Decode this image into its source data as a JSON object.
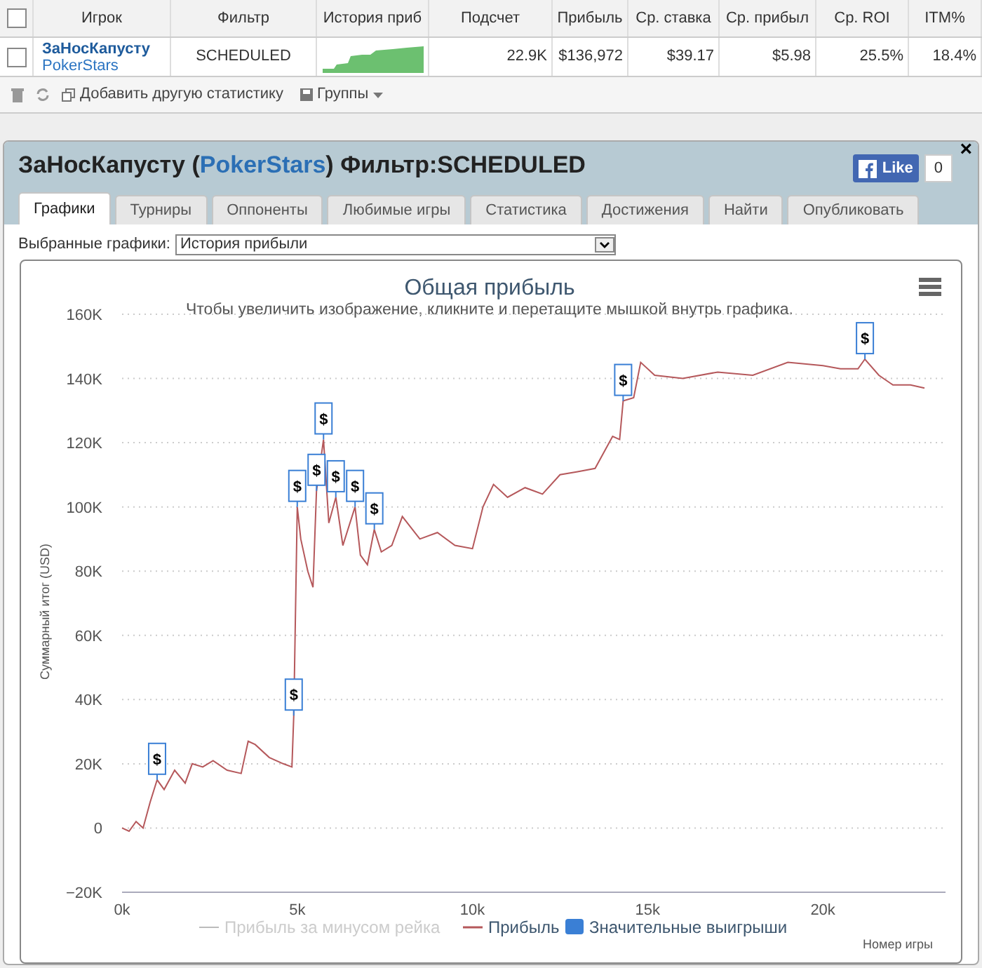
{
  "table": {
    "columns": [
      "Игрок",
      "Фильтр",
      "История приб",
      "Подсчет",
      "Прибыль",
      "Ср. ставка",
      "Ср. прибыл",
      "Ср. ROI",
      "ITM%"
    ],
    "select_all": {
      "checked": false
    },
    "rows": [
      {
        "checked": false,
        "player": "ЗаНосКапусту",
        "site": "PokerStars",
        "filter": "SCHEDULED",
        "count": "22.9K",
        "profit": "$136,972",
        "avg_stake": "$39.17",
        "avg_profit": "$5.98",
        "avg_roi": "25.5%",
        "itm": "18.4%"
      }
    ],
    "toolbar": {
      "add_stat": "Добавить другую статистику",
      "groups": "Группы"
    }
  },
  "panel": {
    "title_player": "ЗаНосКапусту",
    "title_open": " (",
    "title_site": "PokerStars",
    "title_close": ")",
    "title_filter": " Фильтр:SCHEDULED",
    "close": "×",
    "like": "Like",
    "like_count": "0",
    "tabs": [
      {
        "label": "Графики",
        "selected": true
      },
      {
        "label": "Турниры",
        "selected": false
      },
      {
        "label": "Оппоненты",
        "selected": false
      },
      {
        "label": "Любимые игры",
        "selected": false
      },
      {
        "label": "Статистика",
        "selected": false
      },
      {
        "label": "Достижения",
        "selected": false
      },
      {
        "label": "Найти",
        "selected": false
      },
      {
        "label": "Опубликовать",
        "selected": false
      }
    ],
    "select_label": "Выбранные графики:",
    "select_value": "История прибыли",
    "chart_data": {
      "type": "line",
      "title": "Общая прибыль",
      "subtitle": "Чтобы увеличить изображение, кликните и перетащите мышкой внутрь графика.",
      "xlabel": "Номер игры",
      "ylabel": "Суммарный итог (USD)",
      "xticks": [
        {
          "value": 0,
          "label": "0k"
        },
        {
          "value": 5000,
          "label": "5k"
        },
        {
          "value": 10000,
          "label": "10k"
        },
        {
          "value": 15000,
          "label": "15k"
        },
        {
          "value": 20000,
          "label": "20k"
        }
      ],
      "yticks": [
        {
          "value": -20000,
          "label": "−20K"
        },
        {
          "value": 0,
          "label": "0"
        },
        {
          "value": 20000,
          "label": "20K"
        },
        {
          "value": 40000,
          "label": "40K"
        },
        {
          "value": 60000,
          "label": "60K"
        },
        {
          "value": 80000,
          "label": "80K"
        },
        {
          "value": 100000,
          "label": "100K"
        },
        {
          "value": 120000,
          "label": "120K"
        },
        {
          "value": 140000,
          "label": "140K"
        },
        {
          "value": 160000,
          "label": "160K"
        }
      ],
      "xlim": [
        0,
        23500
      ],
      "grid": true,
      "ylim": [
        -20000,
        160000
      ],
      "x": [
        0,
        200,
        400,
        600,
        800,
        1000,
        1200,
        1500,
        1800,
        2000,
        2300,
        2600,
        3000,
        3400,
        3600,
        3800,
        4200,
        4600,
        4850,
        4900,
        5000,
        5100,
        5300,
        5450,
        5550,
        5750,
        5900,
        6100,
        6300,
        6650,
        6800,
        7000,
        7200,
        7400,
        7700,
        8000,
        8500,
        9000,
        9500,
        10000,
        10300,
        10600,
        11000,
        11500,
        12000,
        12500,
        13000,
        13500,
        14000,
        14200,
        14300,
        14600,
        14800,
        15200,
        16000,
        17000,
        18000,
        19000,
        20000,
        20500,
        21000,
        21200,
        21600,
        22000,
        22500,
        22900
      ],
      "series": [
        {
          "name": "Прибыль",
          "color": "#b5585b",
          "values": [
            0,
            -1000,
            2000,
            0,
            8000,
            15000,
            12000,
            18000,
            14000,
            20000,
            19000,
            21000,
            18000,
            17000,
            27000,
            26000,
            22000,
            20000,
            19000,
            35000,
            100000,
            90000,
            80000,
            75000,
            105000,
            121000,
            95000,
            103000,
            88000,
            100000,
            85000,
            82000,
            93000,
            86000,
            88000,
            97000,
            90000,
            92000,
            88000,
            87000,
            100000,
            107000,
            103000,
            106000,
            104000,
            110000,
            111000,
            112000,
            122000,
            121000,
            133000,
            134000,
            145000,
            141000,
            140000,
            142000,
            141000,
            145000,
            144000,
            143000,
            143000,
            146000,
            141000,
            138000,
            138000,
            137000
          ]
        }
      ],
      "annotations": [
        {
          "x": 1000,
          "y": 15000,
          "text": "$"
        },
        {
          "x": 4900,
          "y": 35000,
          "text": "$"
        },
        {
          "x": 5000,
          "y": 100000,
          "text": "$"
        },
        {
          "x": 5550,
          "y": 105000,
          "text": "$"
        },
        {
          "x": 5750,
          "y": 121000,
          "text": "$"
        },
        {
          "x": 6100,
          "y": 103000,
          "text": "$"
        },
        {
          "x": 6650,
          "y": 100000,
          "text": "$"
        },
        {
          "x": 7200,
          "y": 93000,
          "text": "$"
        },
        {
          "x": 14300,
          "y": 133000,
          "text": "$"
        },
        {
          "x": 21200,
          "y": 146000,
          "text": "$"
        }
      ]
    },
    "legend": [
      {
        "label": "Прибыль за минусом рейка",
        "kind": "line",
        "color": "#bbbbbb",
        "visible": false
      },
      {
        "kind": "series",
        "visible": true
      },
      {
        "label": "Значительные выигрыши",
        "kind": "flag",
        "color": "#3a7fd5",
        "visible": true
      }
    ]
  }
}
